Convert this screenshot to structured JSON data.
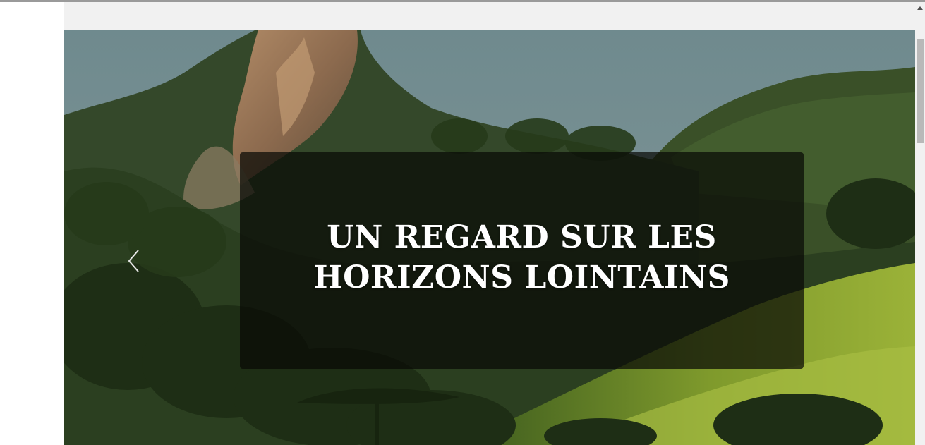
{
  "hero": {
    "title_line1": "UN REGARD SUR LES",
    "title_line2": "HORIZONS LOINTAINS",
    "prev_icon": "chevron-left-icon",
    "image_subject": "forested mountain landscape with rocky peak"
  },
  "scrollbar": {
    "up_icon": "triangle-up-icon",
    "position_fraction": 0.0
  },
  "colors": {
    "caption_overlay": "#0a0c06",
    "caption_text": "#ffffff",
    "top_band": "#f1f1f1",
    "sky": "#6f8a8f",
    "forest": "#2f4a1f",
    "hill_light": "#8ea32e"
  }
}
